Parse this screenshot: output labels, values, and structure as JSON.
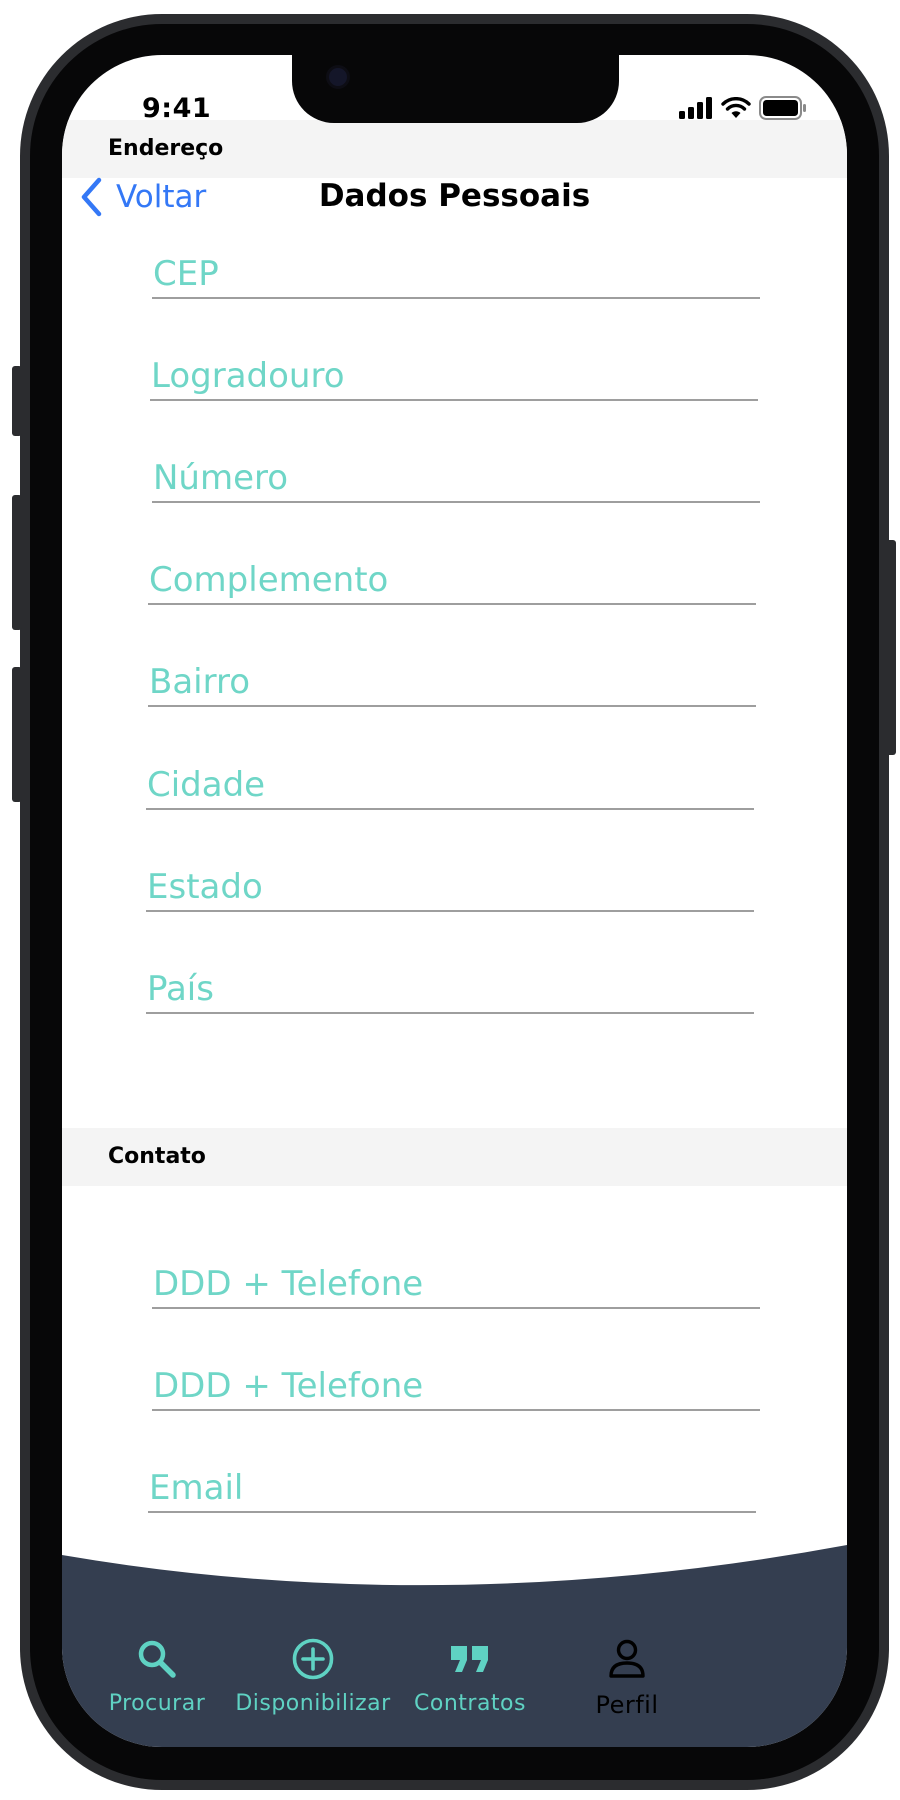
{
  "status_bar": {
    "time": "9:41"
  },
  "nav": {
    "back_label": "Voltar",
    "title": "Dados Pessoais"
  },
  "address_section": {
    "header": "Endereço",
    "fields": [
      {
        "placeholder": "CEP",
        "value": ""
      },
      {
        "placeholder": "Logradouro",
        "value": ""
      },
      {
        "placeholder": "Número",
        "value": ""
      },
      {
        "placeholder": "Complemento",
        "value": ""
      },
      {
        "placeholder": "Bairro",
        "value": ""
      },
      {
        "placeholder": "Cidade",
        "value": ""
      },
      {
        "placeholder": "Estado",
        "value": ""
      },
      {
        "placeholder": "País",
        "value": ""
      }
    ]
  },
  "contact_section": {
    "header": "Contato",
    "fields": [
      {
        "placeholder": "DDD + Telefone",
        "value": ""
      },
      {
        "placeholder": "DDD + Telefone",
        "value": ""
      },
      {
        "placeholder": "Email",
        "value": ""
      }
    ]
  },
  "tab_bar": {
    "items": [
      {
        "label": "Procurar",
        "icon": "search-icon",
        "active": false
      },
      {
        "label": "Disponibilizar",
        "icon": "plus-circle-icon",
        "active": false
      },
      {
        "label": "Contratos",
        "icon": "quote-icon",
        "active": false
      },
      {
        "label": "Perfil",
        "icon": "person-icon",
        "active": true
      }
    ]
  },
  "colors": {
    "accent": "#5fd2c3",
    "link_blue": "#3478f6",
    "tab_bar_bg": "#343e50",
    "section_header_bg": "#f4f4f4"
  }
}
